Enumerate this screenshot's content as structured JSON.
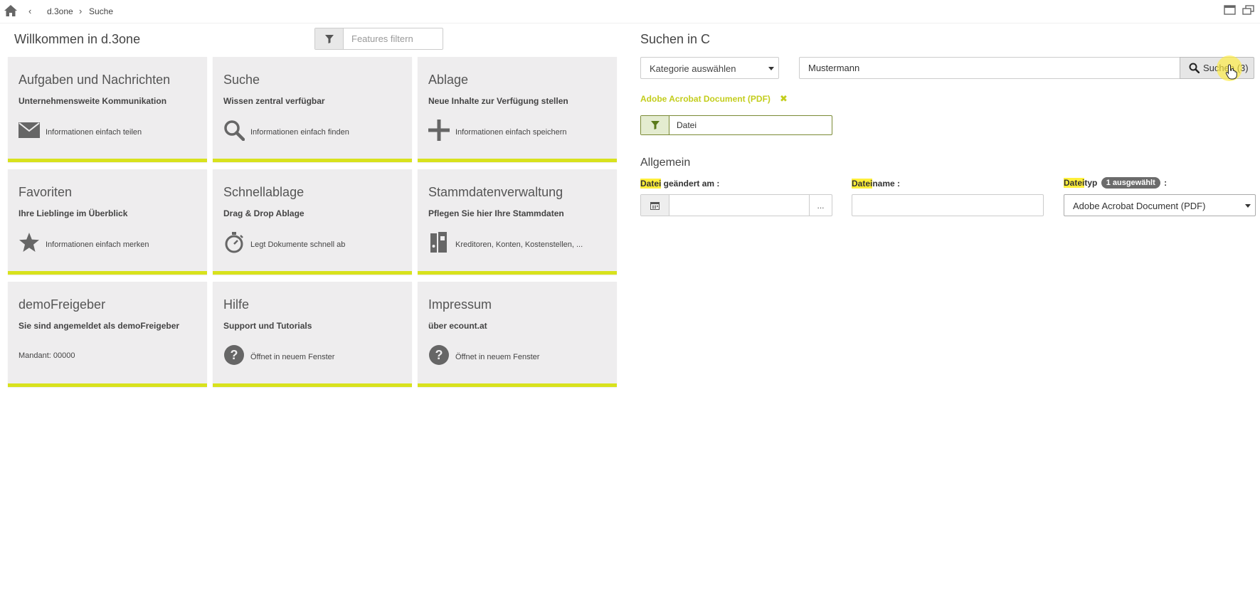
{
  "breadcrumb": {
    "items": [
      "d.3one",
      "Suche"
    ]
  },
  "left": {
    "title": "Willkommen in d.3one",
    "filter_placeholder": "Features filtern"
  },
  "tiles": [
    {
      "title": "Aufgaben und Nachrichten",
      "subtitle": "Unternehmensweite Kommunikation",
      "icon": "envelope-icon",
      "description": "Informationen einfach teilen"
    },
    {
      "title": "Suche",
      "subtitle": "Wissen zentral verfügbar",
      "icon": "search-icon",
      "description": "Informationen einfach finden"
    },
    {
      "title": "Ablage",
      "subtitle": "Neue Inhalte zur Verfügung stellen",
      "icon": "plus-icon",
      "description": "Informationen einfach speichern"
    },
    {
      "title": "Favoriten",
      "subtitle": "Ihre Lieblinge im Überblick",
      "icon": "star-icon",
      "description": "Informationen einfach merken"
    },
    {
      "title": "Schnellablage",
      "subtitle": "Drag & Drop Ablage",
      "icon": "stopwatch-icon",
      "description": "Legt Dokumente schnell ab"
    },
    {
      "title": "Stammdatenverwaltung",
      "subtitle": "Pflegen Sie hier Ihre Stammdaten",
      "icon": "binder-icon",
      "description": "Kreditoren, Konten, Kostenstellen, ..."
    },
    {
      "title": "demoFreigeber",
      "subtitle": "Sie sind angemeldet als demoFreigeber",
      "icon": "",
      "description": "Mandant: 00000"
    },
    {
      "title": "Hilfe",
      "subtitle": "Support und Tutorials",
      "icon": "question-icon",
      "description": "Öffnet in neuem Fenster"
    },
    {
      "title": "Impressum",
      "subtitle": "über ecount.at",
      "icon": "question-icon",
      "description": "Öffnet in neuem Fenster"
    }
  ],
  "search": {
    "title": "Suchen in C",
    "category_placeholder": "Kategorie auswählen",
    "query": "Mustermann",
    "button_label": "Suchen (3)",
    "active_doc_type": "Adobe Acrobat Document (PDF)",
    "field_filter_value": "Datei"
  },
  "general": {
    "title": "Allgemein",
    "date_label_hl": "Datei",
    "date_label_rest": " geändert am :",
    "date_more": "...",
    "name_label_hl": "Datei",
    "name_label_rest": "name :",
    "type_label_hl": "Datei",
    "type_label_mid": "typ",
    "type_badge": "1 ausgewählt",
    "type_label_end": " :",
    "type_value": "Adobe Acrobat Document (PDF)"
  },
  "colors": {
    "accent": "#d8e21d",
    "tag": "#c3cd1c",
    "highlight": "#ffef3a"
  }
}
